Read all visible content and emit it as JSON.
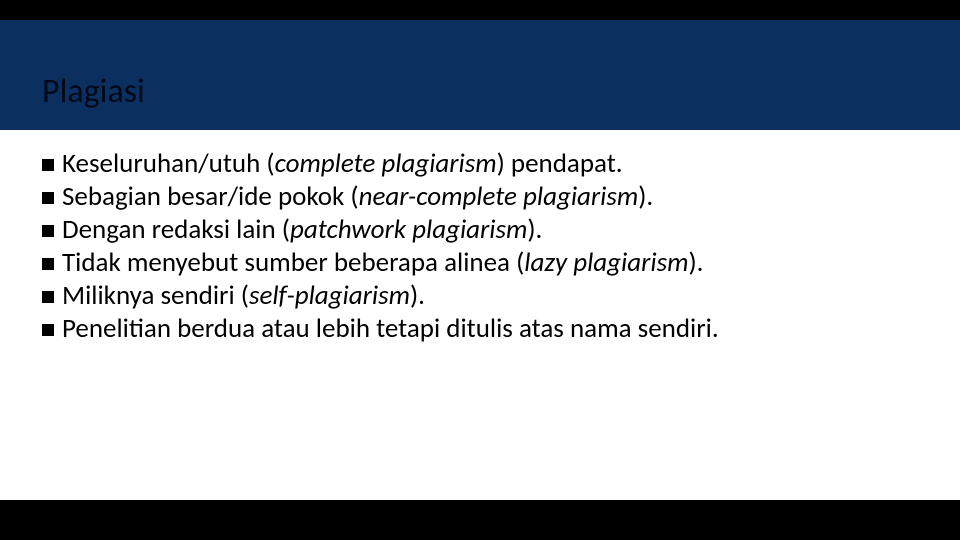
{
  "slide": {
    "title": "Plagiasi",
    "bullets": [
      {
        "html": "Keseluruhan/utuh (<em>complete plagiarism</em>) pendapat."
      },
      {
        "html": "Sebagian besar/ide pokok (<em>near-complete plagiarism</em>)."
      },
      {
        "html": "Dengan redaksi lain (<em>patchwork plagiarism</em>)."
      },
      {
        "html": "Tidak menyebut sumber beberapa alinea (<em>lazy plagiarism</em>)."
      },
      {
        "html": "Miliknya sendiri (<em>self-plagiarism</em>)."
      },
      {
        "html": "Penelitian berdua atau lebih tetapi ditulis atas nama sendiri."
      }
    ]
  }
}
